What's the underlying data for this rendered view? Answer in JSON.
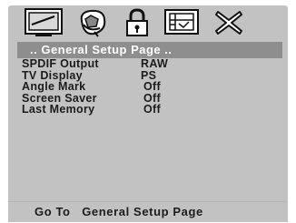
{
  "title": ".. General Setup Page ..",
  "rows": [
    {
      "label": "SPDIF Output",
      "value": "RAW"
    },
    {
      "label": "TV Display",
      "value": "PS"
    },
    {
      "label": "Angle Mark",
      "value": "Off"
    },
    {
      "label": "Screen Saver",
      "value": "Off"
    },
    {
      "label": "Last Memory",
      "value": "Off"
    }
  ],
  "footer": "Go To   General Setup Page",
  "icons": [
    "general-setup-icon",
    "audio-setup-icon",
    "lock-icon",
    "video-setup-icon",
    "exit-icon"
  ],
  "colors": {
    "panel": "#c2c2c2",
    "title_bar": "#8e8e8e"
  }
}
